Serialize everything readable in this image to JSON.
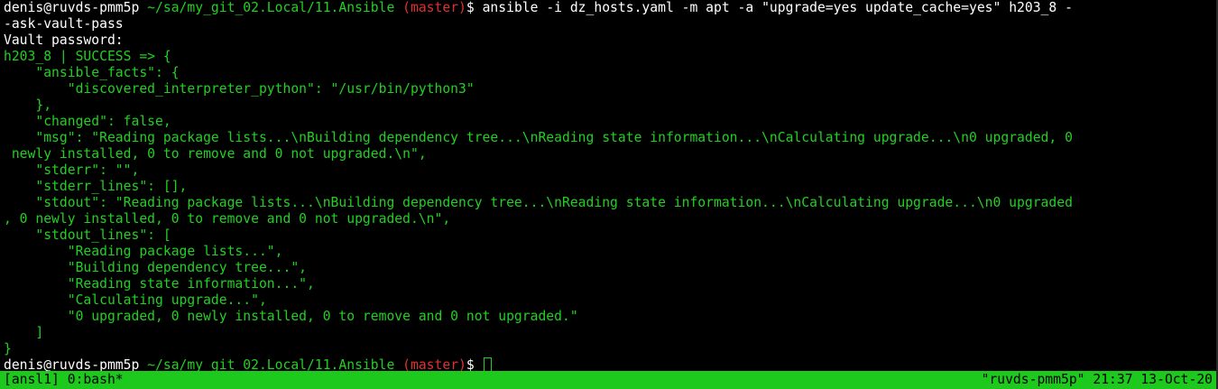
{
  "terminal": {
    "lines": [
      {
        "segments": [
          {
            "text": "denis@ruvds-pmm5p",
            "color": "#ffffff"
          },
          {
            "text": " ~/sa/my_git_02.Local/11.Ansible ",
            "color": "#22d022"
          },
          {
            "text": "(master)",
            "color": "#e03030"
          },
          {
            "text": "$ ansible -i dz_hosts.yaml -m apt -a \"upgrade=yes update_cache=yes\" h203_8 -",
            "color": "#ffffff"
          }
        ]
      },
      {
        "segments": [
          {
            "text": "-ask-vault-pass",
            "color": "#ffffff"
          }
        ]
      },
      {
        "segments": [
          {
            "text": "Vault password:",
            "color": "#ffffff"
          }
        ]
      },
      {
        "segments": [
          {
            "text": "h203_8 | SUCCESS => {",
            "color": "#22d022"
          }
        ]
      },
      {
        "segments": [
          {
            "text": "    \"ansible_facts\": {",
            "color": "#22d022"
          }
        ]
      },
      {
        "segments": [
          {
            "text": "        \"discovered_interpreter_python\": \"/usr/bin/python3\"",
            "color": "#22d022"
          }
        ]
      },
      {
        "segments": [
          {
            "text": "    },",
            "color": "#22d022"
          }
        ]
      },
      {
        "segments": [
          {
            "text": "    \"changed\": false,",
            "color": "#22d022"
          }
        ]
      },
      {
        "segments": [
          {
            "text": "    \"msg\": \"Reading package lists...\\nBuilding dependency tree...\\nReading state information...\\nCalculating upgrade...\\n0 upgraded, 0",
            "color": "#22d022"
          }
        ]
      },
      {
        "segments": [
          {
            "text": " newly installed, 0 to remove and 0 not upgraded.\\n\",",
            "color": "#22d022"
          }
        ]
      },
      {
        "segments": [
          {
            "text": "    \"stderr\": \"\",",
            "color": "#22d022"
          }
        ]
      },
      {
        "segments": [
          {
            "text": "    \"stderr_lines\": [],",
            "color": "#22d022"
          }
        ]
      },
      {
        "segments": [
          {
            "text": "    \"stdout\": \"Reading package lists...\\nBuilding dependency tree...\\nReading state information...\\nCalculating upgrade...\\n0 upgraded",
            "color": "#22d022"
          }
        ]
      },
      {
        "segments": [
          {
            "text": ", 0 newly installed, 0 to remove and 0 not upgraded.\\n\",",
            "color": "#22d022"
          }
        ]
      },
      {
        "segments": [
          {
            "text": "    \"stdout_lines\": [",
            "color": "#22d022"
          }
        ]
      },
      {
        "segments": [
          {
            "text": "        \"Reading package lists...\",",
            "color": "#22d022"
          }
        ]
      },
      {
        "segments": [
          {
            "text": "        \"Building dependency tree...\",",
            "color": "#22d022"
          }
        ]
      },
      {
        "segments": [
          {
            "text": "        \"Reading state information...\",",
            "color": "#22d022"
          }
        ]
      },
      {
        "segments": [
          {
            "text": "        \"Calculating upgrade...\",",
            "color": "#22d022"
          }
        ]
      },
      {
        "segments": [
          {
            "text": "        \"0 upgraded, 0 newly installed, 0 to remove and 0 not upgraded.\"",
            "color": "#22d022"
          }
        ]
      },
      {
        "segments": [
          {
            "text": "    ]",
            "color": "#22d022"
          }
        ]
      },
      {
        "segments": [
          {
            "text": "}",
            "color": "#22d022"
          }
        ]
      },
      {
        "segments": [
          {
            "text": "denis@ruvds-pmm5p",
            "color": "#ffffff"
          },
          {
            "text": " ~/sa/my_git_02.Local/11.Ansible ",
            "color": "#22d022"
          },
          {
            "text": "(master)",
            "color": "#e03030"
          },
          {
            "text": "$ ",
            "color": "#ffffff"
          }
        ],
        "cursor": true
      }
    ]
  },
  "statusbar": {
    "left": "[ansl1] 0:bash*",
    "right": "\"ruvds-pmm5p\" 21:37 13-Oct-20",
    "background": "#1ec91e"
  },
  "colors": {
    "background": "#000000",
    "prompt_user": "#ffffff",
    "prompt_path": "#22d022",
    "git_branch": "#e03030",
    "output": "#22d022"
  }
}
